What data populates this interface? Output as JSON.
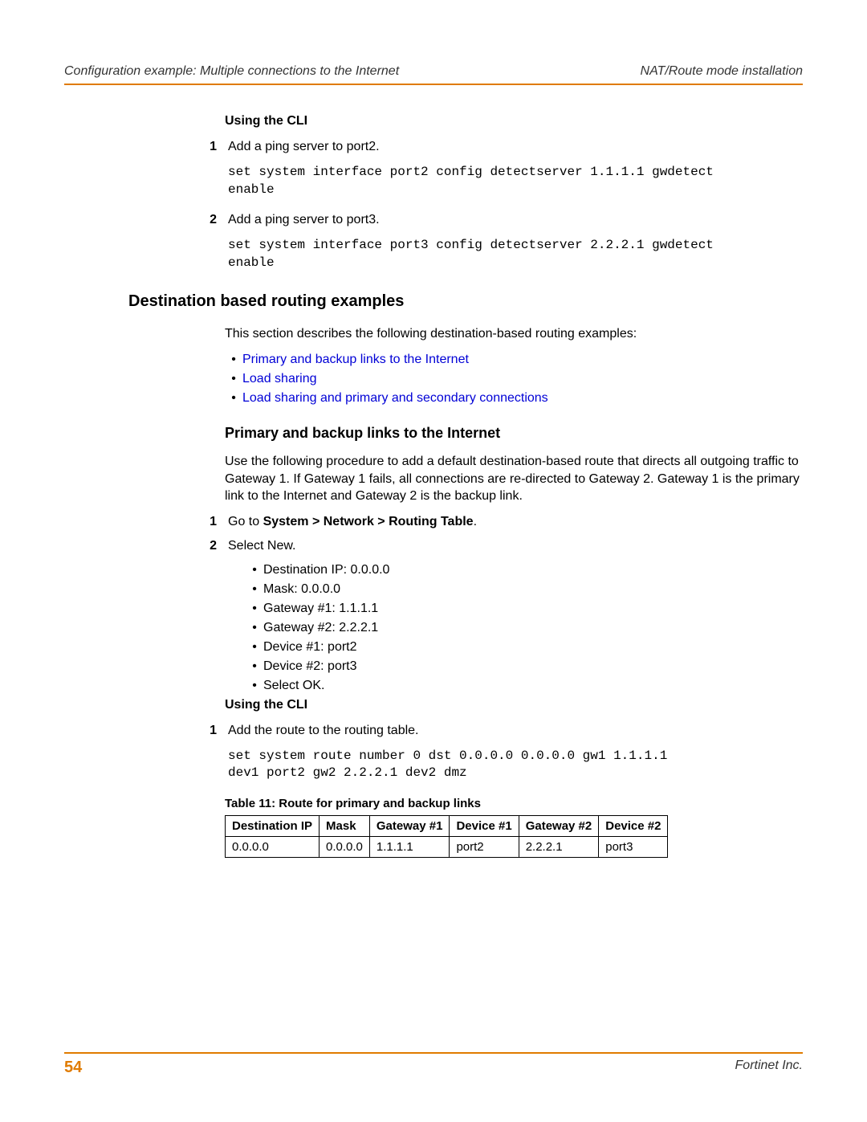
{
  "header": {
    "left": "Configuration example: Multiple connections to the Internet",
    "right": "NAT/Route mode installation"
  },
  "cli1": {
    "heading": "Using the CLI",
    "steps": [
      {
        "num": "1",
        "text": "Add a ping server to port2."
      },
      {
        "num": "2",
        "text": "Add a ping server to port3."
      }
    ],
    "code": [
      "set system interface port2 config detectserver 1.1.1.1 gwdetect\nenable",
      "set system interface port3 config detectserver 2.2.2.1 gwdetect\nenable"
    ]
  },
  "section2": {
    "heading": "Destination based routing examples",
    "intro": "This section describes the following destination-based routing examples:",
    "links": [
      "Primary and backup links to the Internet",
      "Load sharing",
      "Load sharing and primary and secondary connections"
    ]
  },
  "section3": {
    "heading": "Primary and backup links to the Internet",
    "para": "Use the following procedure to add a default destination-based route that directs all outgoing traffic to Gateway 1. If Gateway 1 fails, all connections are re-directed to Gateway 2. Gateway 1 is the primary link to the Internet and Gateway 2 is the backup link.",
    "steps": {
      "s1": {
        "num": "1",
        "prefix": "Go to ",
        "bold": "System > Network > Routing Table",
        "suffix": "."
      },
      "s2": {
        "num": "2",
        "text": "Select New."
      }
    },
    "bullets": [
      "Destination IP: 0.0.0.0",
      "Mask: 0.0.0.0",
      "Gateway #1: 1.1.1.1",
      "Gateway #2: 2.2.2.1",
      "Device #1: port2",
      "Device #2: port3",
      "Select OK."
    ]
  },
  "cli2": {
    "heading": "Using the CLI",
    "step": {
      "num": "1",
      "text": "Add the route to the routing table."
    },
    "code": "set system route number 0 dst 0.0.0.0 0.0.0.0 gw1 1.1.1.1\ndev1 port2 gw2 2.2.2.1 dev2 dmz"
  },
  "table": {
    "caption": "Table 11: Route for primary and backup links",
    "headers": [
      "Destination IP",
      "Mask",
      "Gateway #1",
      "Device #1",
      "Gateway #2",
      "Device #2"
    ],
    "row": [
      "0.0.0.0",
      "0.0.0.0",
      "1.1.1.1",
      "port2",
      "2.2.2.1",
      "port3"
    ]
  },
  "footer": {
    "page": "54",
    "right": "Fortinet Inc."
  }
}
